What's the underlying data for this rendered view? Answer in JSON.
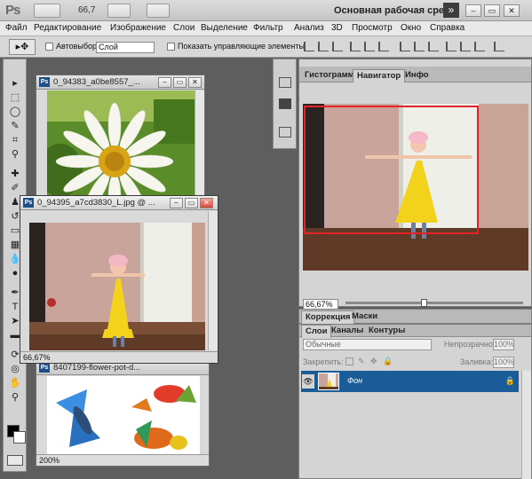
{
  "titlebar": {
    "logo": "Ps",
    "zoom": "66,7",
    "workspace": "Основная рабочая среда",
    "arrow": "»",
    "minimize": "–",
    "restore": "▭",
    "close": "✕"
  },
  "menu": [
    "Файл",
    "Редактирование",
    "Изображение",
    "Слои",
    "Выделение",
    "Фильтр",
    "Анализ",
    "3D",
    "Просмотр",
    "Окно",
    "Справка"
  ],
  "options": {
    "autoselect_label": "Автовыбор:",
    "autoselect_value": "Слой",
    "show_controls_label": "Показать управляющие элементы"
  },
  "docs": [
    {
      "name": "0_94383_a0be8557_...",
      "zoom": ""
    },
    {
      "name": "0_94395_a7cd3830_L.jpg @ ...",
      "zoom": "66,67%"
    },
    {
      "name": "8407199-flower-pot-d...",
      "zoom": "200%"
    }
  ],
  "navigator": {
    "tabs": [
      "Гистограмма",
      "Навигатор",
      "Инфо"
    ],
    "zoom": "66,67%"
  },
  "correction_tabs": [
    "Коррекция",
    "Маски"
  ],
  "layers": {
    "tabs": [
      "Слои",
      "Каналы",
      "Контуры"
    ],
    "blend_mode": "Обычные",
    "opacity_label": "Непрозрачность:",
    "opacity_value": "100%",
    "lock_label": "Закрепить:",
    "fill_label": "Заливка:",
    "fill_value": "100%",
    "layer_name": "Фон"
  },
  "colors": {
    "layer_selected": "#1a5c97",
    "nav_rect": "#e0242a",
    "dress": "#f2d21a"
  }
}
